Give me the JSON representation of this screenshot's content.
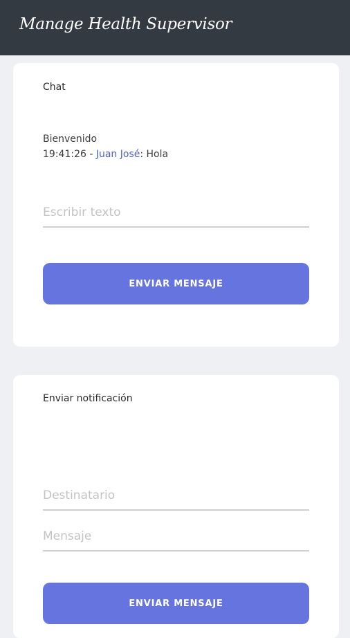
{
  "header": {
    "title": "Manage Health Supervisor"
  },
  "chat": {
    "title": "Chat",
    "welcome": "Bienvenido",
    "messages": [
      {
        "time": "19:41:26",
        "separator": " - ",
        "author": "Juan José",
        "text": ": Hola"
      }
    ],
    "input": {
      "placeholder": "Escribir texto",
      "value": ""
    },
    "send_label": "ENVIAR MENSAJE"
  },
  "notification": {
    "title": "Enviar notificación",
    "recipient": {
      "placeholder": "Destinatario",
      "value": ""
    },
    "message": {
      "placeholder": "Mensaje",
      "value": ""
    },
    "send_label": "ENVIAR MENSAJE"
  },
  "colors": {
    "header_bg": "#343a42",
    "page_bg": "#eef0f4",
    "accent": "#6674df",
    "author": "#4f5bdc"
  }
}
